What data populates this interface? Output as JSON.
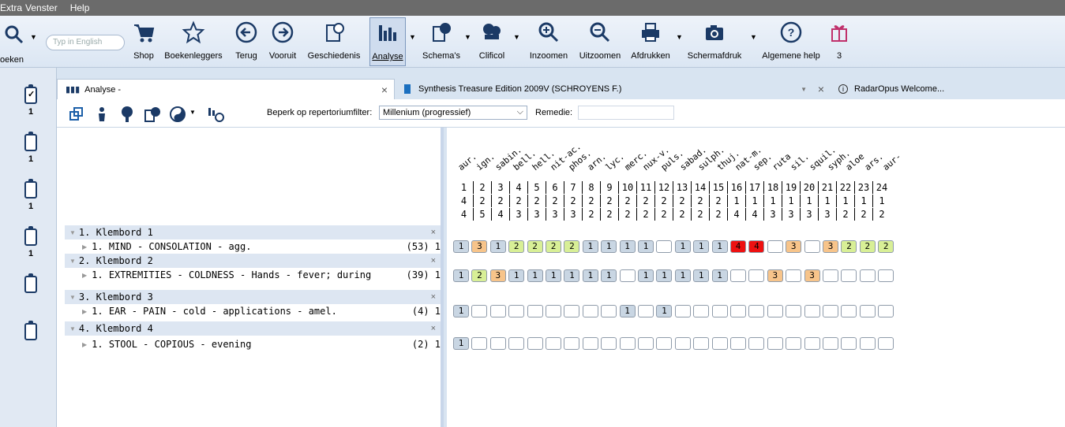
{
  "menu": [
    "Extra",
    "Venster",
    "Help"
  ],
  "search": {
    "placeholder": "Typ in English",
    "left_label": "oeken"
  },
  "toolbar": [
    {
      "label": "Shop",
      "icon": "cart-icon"
    },
    {
      "label": "Boekenleggers",
      "icon": "star-icon"
    },
    {
      "label": "Terug",
      "icon": "back-arrow-icon"
    },
    {
      "label": "Vooruit",
      "icon": "forward-arrow-icon"
    },
    {
      "label": "Geschiedenis",
      "icon": "history-icon"
    },
    {
      "label": "Analyse",
      "icon": "bar-chart-icon"
    },
    {
      "label": "Schema's",
      "icon": "schema-icon"
    },
    {
      "label": "Clificol",
      "icon": "clificol-icon"
    },
    {
      "label": "Inzoomen",
      "icon": "zoom-in-icon"
    },
    {
      "label": "Uitzoomen",
      "icon": "zoom-out-icon"
    },
    {
      "label": "Afdrukken",
      "icon": "printer-icon"
    },
    {
      "label": "Schermafdruk",
      "icon": "camera-icon"
    },
    {
      "label": "Algemene help",
      "icon": "help-icon"
    },
    {
      "label": "3",
      "icon": "gift-icon"
    }
  ],
  "clipboards": [
    "1",
    "1",
    "1",
    "1"
  ],
  "tabs": [
    {
      "label": "Analyse -"
    },
    {
      "label": "Synthesis Treasure Edition 2009V (SCHROYENS F.)"
    },
    {
      "label": "RadarOpus Welcome..."
    }
  ],
  "analysis": {
    "filter_label": "Beperk op repertoriumfilter:",
    "filter_value": "Millenium (progressief)",
    "remedy_label": "Remedie:"
  },
  "groups": [
    {
      "title": "1. Klembord 1",
      "rubric": "1. MIND - CONSOLATION - agg.",
      "count": "(53) 1"
    },
    {
      "title": "2. Klembord 2",
      "rubric": "1. EXTREMITIES - COLDNESS - Hands - fever; during",
      "count": "(39) 1"
    },
    {
      "title": "3. Klembord 3",
      "rubric": "1. EAR - PAIN - cold - applications - amel.",
      "count": "(4) 1"
    },
    {
      "title": "4. Klembord 4",
      "rubric": "1. STOOL - COPIOUS - evening",
      "count": "(2) 1"
    }
  ],
  "remedies": [
    "aur.",
    "ign.",
    "sabin.",
    "bell.",
    "hell.",
    "nit-ac.",
    "phos.",
    "arn.",
    "lyc.",
    "merc.",
    "nux-v.",
    "puls.",
    "sabad.",
    "sulph.",
    "thuj.",
    "nat-m.",
    "sep.",
    "ruta",
    "sil.",
    "squil.",
    "syph.",
    "aloe",
    "ars.",
    "aur-"
  ],
  "numbers_row": [
    "1",
    "2",
    "3",
    "4",
    "5",
    "6",
    "7",
    "8",
    "9",
    "10",
    "11",
    "12",
    "13",
    "14",
    "15",
    "16",
    "17",
    "18",
    "19",
    "20",
    "21",
    "22",
    "23",
    "24"
  ],
  "row_a": [
    "4",
    "2",
    "2",
    "2",
    "2",
    "2",
    "2",
    "2",
    "2",
    "2",
    "2",
    "2",
    "2",
    "2",
    "2",
    "1",
    "1",
    "1",
    "1",
    "1",
    "1",
    "1",
    "1",
    "1"
  ],
  "row_b": [
    "4",
    "5",
    "4",
    "3",
    "3",
    "3",
    "3",
    "2",
    "2",
    "2",
    "2",
    "2",
    "2",
    "2",
    "2",
    "4",
    "4",
    "3",
    "3",
    "3",
    "3",
    "2",
    "2",
    "2"
  ],
  "cells": [
    [
      "1",
      "3",
      "1",
      "2",
      "2",
      "2",
      "2",
      "1",
      "1",
      "1",
      "1",
      "",
      "1",
      "1",
      "1",
      "4",
      "4",
      "",
      "3",
      "",
      "3",
      "2",
      "2",
      "2"
    ],
    [
      "1",
      "2",
      "3",
      "1",
      "1",
      "1",
      "1",
      "1",
      "1",
      "",
      "1",
      "1",
      "1",
      "1",
      "1",
      "",
      "",
      "3",
      "",
      "3",
      "",
      "",
      "",
      ""
    ],
    [
      "1",
      "",
      "",
      "",
      "",
      "",
      "",
      "",
      "",
      "1",
      "",
      "1",
      "",
      "",
      "",
      "",
      "",
      "",
      "",
      "",
      "",
      "",
      "",
      ""
    ],
    [
      "1",
      "",
      "",
      "",
      "",
      "",
      "",
      "",
      "",
      "",
      "",
      "",
      "",
      "",
      "",
      "",
      "",
      "",
      "",
      "",
      "",
      "",
      "",
      ""
    ]
  ],
  "colors": {
    "1": "#c9d6e3",
    "2": "#d8ef96",
    "3": "#f7c48a",
    "4": "#ee1111"
  }
}
